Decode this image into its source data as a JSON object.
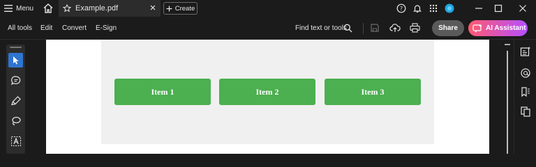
{
  "titlebar": {
    "menu_label": "Menu",
    "tab_title": "Example.pdf",
    "create_label": "Create"
  },
  "menubar": {
    "items": [
      "All tools",
      "Edit",
      "Convert",
      "E-Sign"
    ],
    "find_label": "Find text or tools",
    "share_label": "Share",
    "ai_label": "AI Assistant"
  },
  "document": {
    "buttons": [
      "Item 1",
      "Item 2",
      "Item 3"
    ]
  },
  "colors": {
    "accent_blue": "#2f74d0",
    "button_green": "#4caf50",
    "ai_gradient_start": "#ff5a70",
    "ai_gradient_end": "#b44fff"
  }
}
